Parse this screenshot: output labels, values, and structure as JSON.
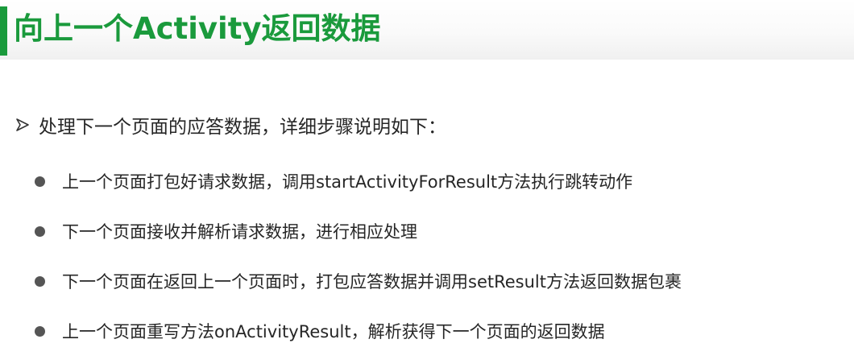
{
  "slide": {
    "title": "向上一个Activity返回数据",
    "lead": "处理下一个页面的应答数据，详细步骤说明如下：",
    "bullets": [
      "上一个页面打包好请求数据，调用startActivityForResult方法执行跳转动作",
      "下一个页面接收并解析请求数据，进行相应处理",
      "下一个页面在返回上一个页面时，打包应答数据并调用setResult方法返回数据包裹",
      "上一个页面重写方法onActivityResult，解析获得下一个页面的返回数据"
    ]
  },
  "colors": {
    "accent": "#1a9a3c",
    "text": "#262626",
    "bullet": "#555555"
  },
  "icons": {
    "lead": "arrow-bullet-icon",
    "item": "dot-bullet-icon"
  }
}
